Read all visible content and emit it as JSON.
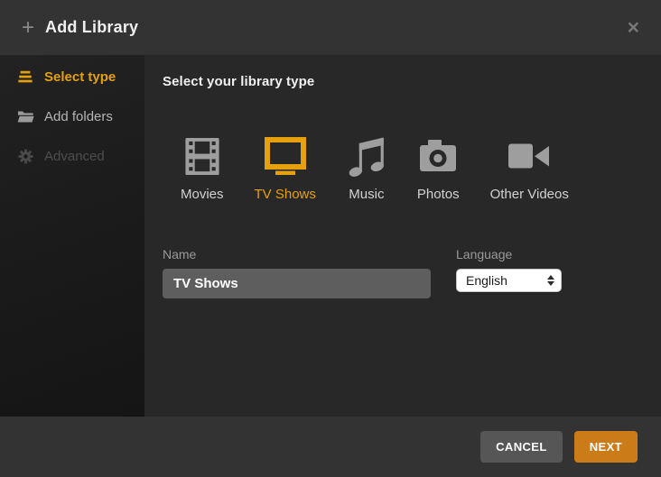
{
  "dialog": {
    "title": "Add Library",
    "plus_glyph": "+",
    "close_glyph": "×"
  },
  "sidebar": {
    "items": [
      {
        "label": "Select type",
        "icon": "list-lines-icon",
        "state": "active"
      },
      {
        "label": "Add folders",
        "icon": "folder-icon",
        "state": "normal"
      },
      {
        "label": "Advanced",
        "icon": "gear-icon",
        "state": "disabled"
      }
    ]
  },
  "content": {
    "heading": "Select your library type",
    "types": [
      {
        "label": "Movies",
        "icon": "film-icon",
        "selected": false
      },
      {
        "label": "TV Shows",
        "icon": "tv-icon",
        "selected": true
      },
      {
        "label": "Music",
        "icon": "music-note-icon",
        "selected": false
      },
      {
        "label": "Photos",
        "icon": "camera-icon",
        "selected": false
      },
      {
        "label": "Other Videos",
        "icon": "video-camera-icon",
        "selected": false
      }
    ],
    "name_field": {
      "label": "Name",
      "value": "TV Shows"
    },
    "language_field": {
      "label": "Language",
      "value": "English"
    }
  },
  "footer": {
    "cancel_label": "CANCEL",
    "next_label": "NEXT"
  },
  "colors": {
    "accent_gold": "#e5a00d",
    "next_orange": "#cc7b19",
    "header_bg": "#333333",
    "content_bg": "#282828",
    "sidebar_bg": "#1a1a1a",
    "input_bg": "#5e5e5e"
  }
}
